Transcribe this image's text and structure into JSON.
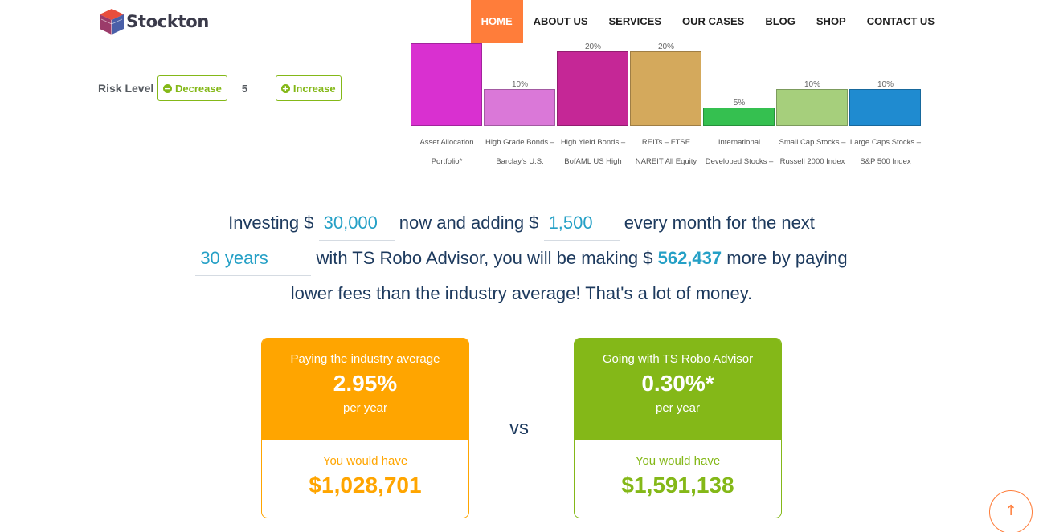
{
  "brand": {
    "name": "Stockton",
    "logo_icon": "cube-logo-icon"
  },
  "nav": {
    "items": [
      {
        "label": "HOME",
        "active": true
      },
      {
        "label": "ABOUT US",
        "active": false
      },
      {
        "label": "SERVICES",
        "active": false
      },
      {
        "label": "OUR CASES",
        "active": false
      },
      {
        "label": "BLOG",
        "active": false
      },
      {
        "label": "SHOP",
        "active": false
      },
      {
        "label": "CONTACT US",
        "active": false
      }
    ]
  },
  "risk": {
    "label": "Risk Level",
    "decrease_label": "Decrease",
    "increase_label": "Increase",
    "value": "5"
  },
  "chart_data": {
    "type": "bar",
    "categories": [
      [
        "Asset Allocation",
        "Portfolio*"
      ],
      [
        "High Grade Bonds –",
        "Barclay's U.S."
      ],
      [
        "High Yield Bonds –",
        "BofAML US High"
      ],
      [
        "REITs – FTSE",
        "NAREIT All Equity"
      ],
      [
        "International",
        "Developed Stocks –"
      ],
      [
        "Small Cap Stocks –",
        "Russell 2000 Index"
      ],
      [
        "Large Caps Stocks –",
        "S&P 500 Index"
      ]
    ],
    "values": [
      null,
      10,
      20,
      20,
      5,
      10,
      10
    ],
    "value_labels": [
      "",
      "10%",
      "20%",
      "20%",
      "5%",
      "10%",
      "10%"
    ],
    "colors": [
      "#d930d0",
      "#da78d8",
      "#c52796",
      "#d4a95c",
      "#35c050",
      "#a6cf7c",
      "#1f8bd0"
    ],
    "ylim": [
      0,
      20
    ]
  },
  "calculator": {
    "text1": "Investing $",
    "initial": "30,000",
    "text2": "now and adding $",
    "monthly": "1,500",
    "text3": "every month for the next",
    "years": "30 years",
    "text4": "with TS Robo Advisor, you will be making $",
    "savings": "562,437",
    "text5": "more by paying",
    "text6": "lower fees than the industry average! That's a lot of money."
  },
  "cards": {
    "industry": {
      "title": "Paying the industry average",
      "rate": "2.95%",
      "period": "per year",
      "result_label": "You would have",
      "result_value": "$1,028,701",
      "color": "#ffa500"
    },
    "vs": "vs",
    "robo": {
      "title": "Going with TS Robo Advisor",
      "rate": "0.30%*",
      "period": "per year",
      "result_label": "You would have",
      "result_value": "$1,591,138",
      "color": "#84b818"
    }
  },
  "back_to_top": {
    "icon": "arrow-up-icon"
  }
}
